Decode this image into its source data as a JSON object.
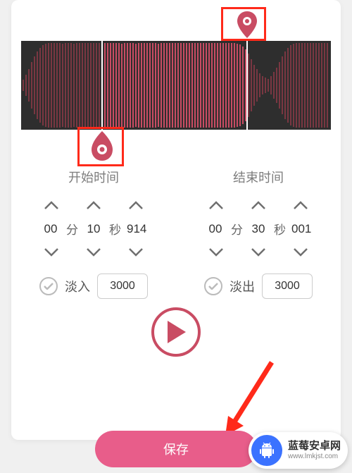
{
  "startTime": {
    "title": "开始时间",
    "min": "00",
    "minUnit": "分",
    "sec": "10",
    "secUnit": "秒",
    "ms": "914"
  },
  "endTime": {
    "title": "结束时间",
    "min": "00",
    "minUnit": "分",
    "sec": "30",
    "secUnit": "秒",
    "ms": "001"
  },
  "fadeIn": {
    "label": "淡入",
    "value": "3000"
  },
  "fadeOut": {
    "label": "淡出",
    "value": "3000"
  },
  "saveLabel": "保存",
  "watermark": {
    "title": "蓝莓安卓网",
    "url": "www.lmkjst.com"
  },
  "colors": {
    "accentPink": "#c94c63",
    "saveBg": "#e85d8a",
    "badgeBlue": "#3b72ff",
    "highlightRed": "#ff2a1a"
  }
}
